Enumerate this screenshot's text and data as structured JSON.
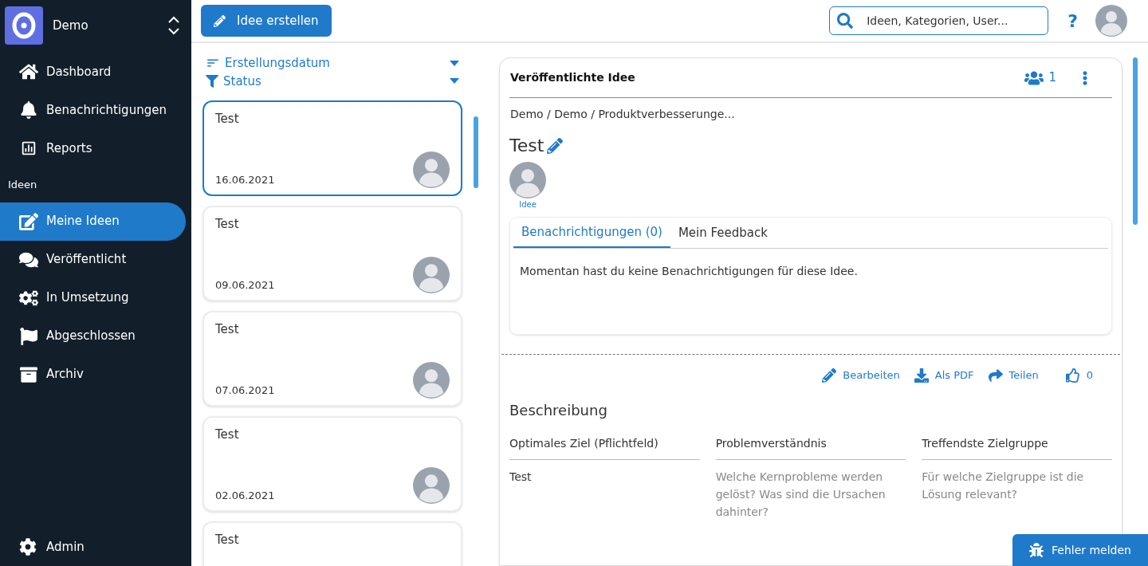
{
  "workspace": {
    "name": "Demo"
  },
  "nav": [
    {
      "label": "Dashboard",
      "selected": false
    },
    {
      "label": "Benachrichtigungen",
      "selected": false
    },
    {
      "label": "Reports",
      "selected": false
    },
    {
      "kind": "section",
      "label": "Ideen"
    },
    {
      "label": "Meine Ideen",
      "selected": true
    },
    {
      "label": "Veröffentlicht",
      "selected": false
    },
    {
      "label": "In Umsetzung",
      "selected": false
    },
    {
      "label": "Abgeschlossen",
      "selected": false
    },
    {
      "label": "Archiv",
      "selected": false
    }
  ],
  "admin": {
    "label": "Admin"
  },
  "create_button": "Idee erstellen",
  "search": {
    "placeholder": "Ideen, Kategorien, User..."
  },
  "help": "?",
  "filters": [
    {
      "label": "Erstellungsdatum"
    },
    {
      "label": "Status"
    }
  ],
  "ideas": [
    {
      "title": "Test",
      "date": "16.06.2021",
      "selected": true
    },
    {
      "title": "Test",
      "date": "09.06.2021",
      "selected": false
    },
    {
      "title": "Test",
      "date": "07.06.2021",
      "selected": false
    },
    {
      "title": "Test",
      "date": "02.06.2021",
      "selected": false
    },
    {
      "title": "Test",
      "selected": false
    }
  ],
  "detail": {
    "header": "Veröffentlichte Idee",
    "members": "1",
    "breadcrumb": "Demo / Demo / Produktverbesserunge...",
    "title": "Test",
    "author_role": "Idee",
    "tabs": [
      {
        "label": "Benachrichtigungen (0)",
        "selected": true
      },
      {
        "label": "Mein Feedback",
        "selected": false
      }
    ],
    "tab_content": "Momentan hast du keine Benachrichtigungen für diese Idee.",
    "actions": [
      {
        "label": "Bearbeiten"
      },
      {
        "label": "Als PDF"
      },
      {
        "label": "Teilen"
      },
      {
        "label": "0"
      }
    ],
    "section": "Beschreibung",
    "fields": [
      {
        "label": "Optimales Ziel (Pflichtfeld)",
        "value": "Test"
      },
      {
        "label": "Problemverständnis",
        "hint": "Welche Kernprobleme werden gelöst? Was sind die Ursachen dahinter?"
      },
      {
        "label": "Treffendste Zielgruppe",
        "hint": "Für welche Zielgruppe ist die Lösung relevant?"
      }
    ]
  },
  "report_button": "Fehler melden"
}
